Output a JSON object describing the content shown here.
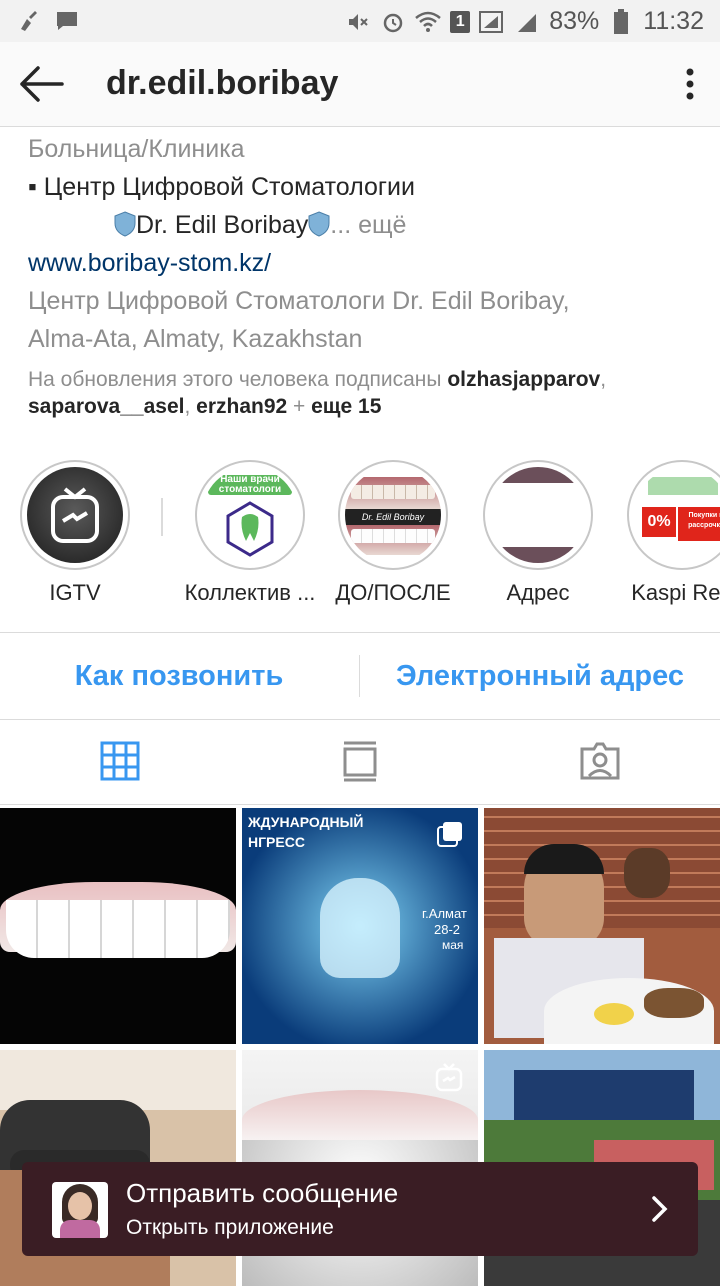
{
  "status_bar": {
    "battery_percent": "83%",
    "time": "11:32",
    "notification_count": "1"
  },
  "header": {
    "username": "dr.edil.boribay"
  },
  "bio": {
    "category": "Больница/Клиника",
    "line1": "▪ Центр Цифровой Стоматологии",
    "line2": "Dr. Edil Boribay",
    "more": "... ещё",
    "website": "www.boribay-stom.kz/",
    "address_line1": "Центр Цифровой Стоматологи Dr. Edil Boribay,",
    "address_line2": "Alma-Ata, Almaty, Kazakhstan"
  },
  "followed_by": {
    "prefix": "На обновления этого человека подписаны ",
    "user1": "olzhasjapparov",
    "sep1": ",",
    "user2": "saparova__asel",
    "sep2": ", ",
    "user3": "erzhan92",
    "plus": " + ",
    "more": "еще 15"
  },
  "highlights": [
    {
      "label": "IGTV"
    },
    {
      "label": "Коллектив ...",
      "cover_text": "Наши врачи стоматологи"
    },
    {
      "label": "ДО/ПОСЛЕ",
      "cover_text": "Dr. Edil Boribay"
    },
    {
      "label": "Адрес"
    },
    {
      "label": "Kaspi Red",
      "cover_text1": "0%",
      "cover_text2": "Покупки в рассрочку"
    }
  ],
  "contacts": {
    "call": "Как позвонить",
    "email": "Электронный адрес"
  },
  "tabs": [
    "grid",
    "feed",
    "tagged"
  ],
  "posts": [
    {
      "type": "photo"
    },
    {
      "type": "photo",
      "text1": "ЖДУНАРОДНЫЙ",
      "text2": "НГРЕСС",
      "text3": "г.Алмат",
      "text4": "28-2",
      "text5": "мая"
    },
    {
      "type": "photo"
    },
    {
      "type": "photo"
    },
    {
      "type": "igtv"
    },
    {
      "type": "photo"
    }
  ],
  "app_banner": {
    "title": "Отправить сообщение",
    "subtitle": "Открыть приложение"
  },
  "colors": {
    "accent_blue": "#3897f0",
    "link_dark_blue": "#003569",
    "banner_bg": "#3a1d24"
  }
}
